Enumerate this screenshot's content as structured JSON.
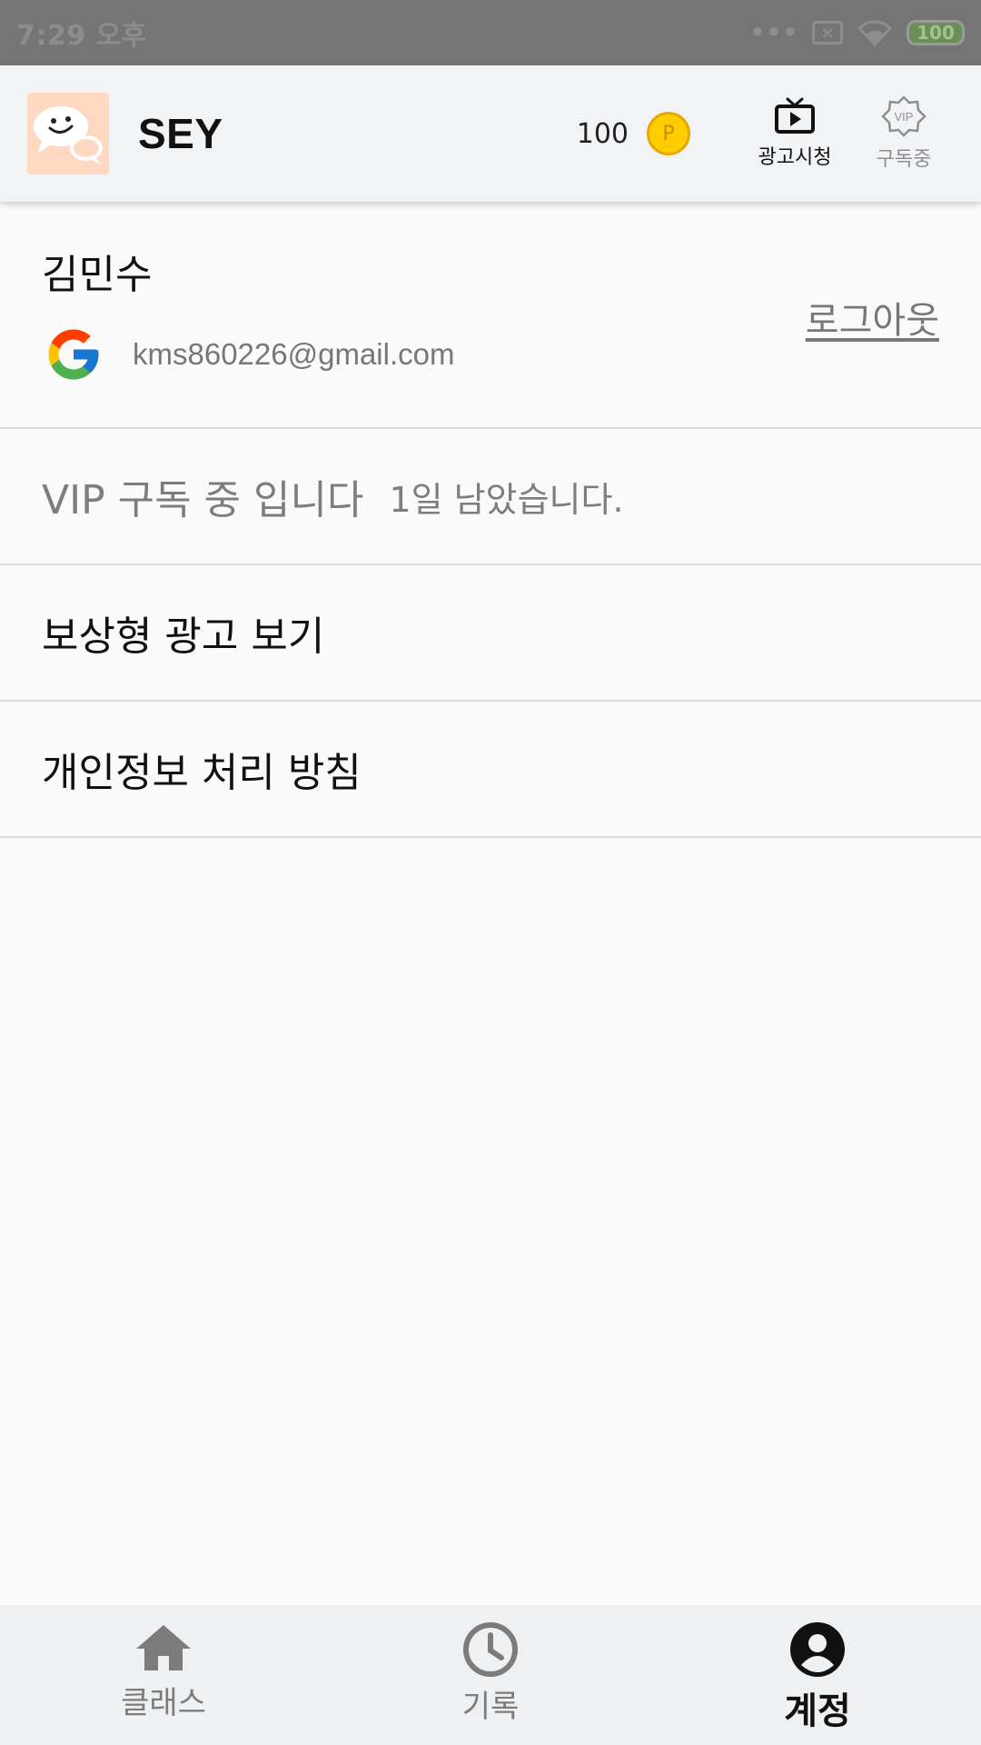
{
  "status_bar": {
    "time": "7:29 오후",
    "battery": "100"
  },
  "app_bar": {
    "title": "SEY",
    "points": "100",
    "coin_symbol": "P",
    "watch_ad_label": "광고시청",
    "subscription_label": "구독중",
    "vip_badge": "VIP"
  },
  "account": {
    "name": "김민수",
    "email": "kms860226@gmail.com",
    "logout_label": "로그아웃"
  },
  "vip": {
    "status_text": "VIP 구독 중 입니다",
    "remaining_text": "1일 남았습니다."
  },
  "menu": [
    {
      "label": "보상형 광고 보기"
    },
    {
      "label": "개인정보 처리 방침"
    }
  ],
  "bottom_nav": [
    {
      "label": "클래스",
      "icon": "home-icon",
      "active": false
    },
    {
      "label": "기록",
      "icon": "clock-icon",
      "active": false
    },
    {
      "label": "계정",
      "icon": "account-icon",
      "active": true
    }
  ],
  "colors": {
    "status_bar": "#757575",
    "app_bar": "#f2f3f5",
    "coin": "#ffcc00",
    "logo_bg": "#ffd8c2",
    "text_primary": "#111111",
    "text_secondary": "#7d7d7d"
  }
}
